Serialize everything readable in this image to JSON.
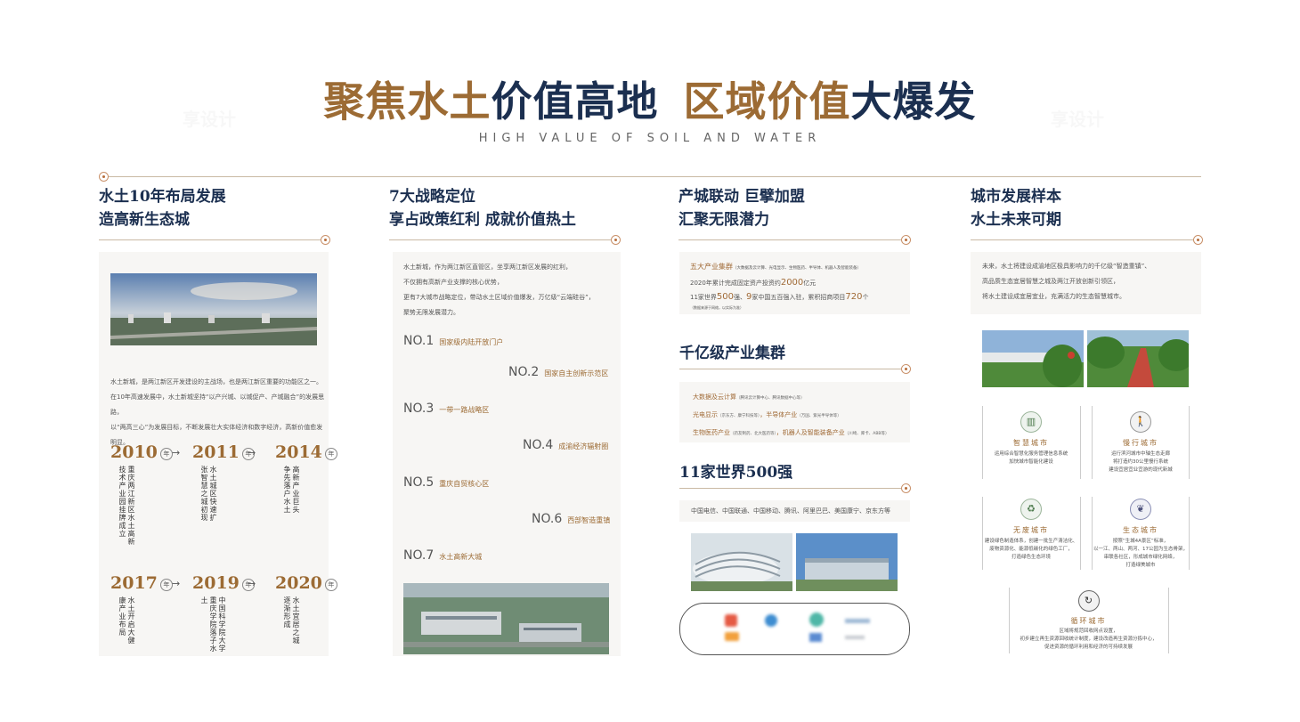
{
  "title": {
    "part1": "聚焦水土",
    "part2": "价值高地",
    "part3": "区域价值",
    "part4": "大爆发"
  },
  "subtitle": "HIGH VALUE OF SOIL AND WATER",
  "col1": {
    "head1": "水土10年布局发展",
    "head2": "造高新生态城",
    "para": [
      "水土新城，是两江新区开发建设的主战场，也是两江新区重要的功能区之一。",
      "在10年高速发展中，水土新城坚持“以产兴城、以城促产、产城融合”的发展思路，",
      "以“两高三心”为发展目标，不断发展壮大实体经济和数字经济，高新价值愈发明显。"
    ],
    "nian": "年",
    "milestones": [
      {
        "year": "2010",
        "text": "重庆两江新区水土高新技术产业园挂牌成立"
      },
      {
        "year": "2011",
        "text": "水土城区快速扩张智慧之城初现"
      },
      {
        "year": "2014",
        "text": "高新产业巨头争先落户水土"
      },
      {
        "year": "2017",
        "text": "水土开启大健康产业布局"
      },
      {
        "year": "2019",
        "text": "中国科学院大学重庆学院落子水土"
      },
      {
        "year": "2020",
        "text": "水土宜居之城逐渐形成"
      }
    ]
  },
  "col2": {
    "head1": "7大战略定位",
    "head2": "享占政策红利 成就价值热土",
    "para": [
      "水土新城，作为两江新区直管区，坐享两江新区发展的红利，",
      "不仅拥有高新产业支撑的核心优势，",
      "更有7大城市战略定位，带动水土区域价值爆发，万亿级“云端硅谷”，",
      "聚势无限发展潜力。"
    ],
    "items": [
      {
        "no": "NO.1",
        "label": "国家级内陆开放门户"
      },
      {
        "no": "NO.2",
        "label": "国家自主创新示范区"
      },
      {
        "no": "NO.3",
        "label": "一带一路战略区"
      },
      {
        "no": "NO.4",
        "label": "成渝经济辐射圈"
      },
      {
        "no": "NO.5",
        "label": "重庆自贸核心区"
      },
      {
        "no": "NO.6",
        "label": "西部智造重镇"
      },
      {
        "no": "NO.7",
        "label": "水土高新大城"
      }
    ]
  },
  "col3": {
    "head1": "产城联动 巨擘加盟",
    "head2": "汇聚无限潜力",
    "box1": {
      "l1a": "五大产业集群",
      "l1b": "（大数据及云计算、光电显示、生物医药、半导体、机器人及智能装备）",
      "l2a": "2020年累计完成固定资产投资约",
      "l2b": "2000",
      "l2c": "亿元",
      "l3a": "11家世界",
      "l3b": "500",
      "l3c": "强、",
      "l3d": "9",
      "l3e": "家中国五百强入驻，累积招商项目",
      "l3f": "720",
      "l3g": "个",
      "l4": "（数据来源于网络，以实际为准）"
    },
    "sec2": "千亿级产业集群",
    "industries": [
      {
        "a": "大数据及云计算",
        "b": "（腾讯云计算中心、腾讯数据中心等）"
      },
      {
        "a": "光电显示",
        "b": "（京东方、康宁科技等）",
        "c": "半导体产业",
        "d": "（万国、紫光半导体等）"
      },
      {
        "a": "生物医药产业",
        "b": "（药友制药、北大医药等）",
        "c": "机器人及智能装备产业",
        "d": "（川崎、库卡、ABB等）"
      }
    ],
    "sec3": "11家世界500强",
    "companies": "中国电信、中国联通、中国移动、腾讯、阿里巴巴、美国康宁、京东方等"
  },
  "col4": {
    "head1": "城市发展样本",
    "head2": "水土未来可期",
    "para": [
      "未来，水土将建设成渝地区极具影响力的千亿级“智造重镇”、",
      "高品质生态宜居智慧之城及两江开放创新引领区，",
      "将水土建设成宜居宜业，充满活力的生态智慧城市。"
    ],
    "cards": [
      {
        "title": "智慧城市",
        "icon": "smart-city-icon",
        "glyph": "▥",
        "desc": [
          "运用综合智慧化服务管理信息系统",
          "加快城市智能化建设"
        ]
      },
      {
        "title": "慢行城市",
        "icon": "walking-icon",
        "glyph": "🚶",
        "desc": [
          "运行滨河城市中轴生态走廊",
          "将打造约30公里慢行系统",
          "建设宜居宜业宜游的现代新城"
        ]
      },
      {
        "title": "无废城市",
        "icon": "leaf-icon",
        "glyph": "♻",
        "desc": [
          "建设绿色制造体系，创建一批生产清洁化、",
          "废物资源化、能源低碳化的绿色工厂，",
          "打造绿色生态环境"
        ]
      },
      {
        "title": "生态城市",
        "icon": "ecology-icon",
        "glyph": "❦",
        "desc": [
          "按照“生城4A景区”标准，",
          "以一江、两山、两河、17公园为生态骨架，",
          "串联各社区，形成城市绿化网络，",
          "打造绿美城市"
        ]
      },
      {
        "title": "循环城市",
        "icon": "recycle-icon",
        "glyph": "↻",
        "desc": [
          "区域将规范回收网点设置，",
          "初步建立再生资源回收统计制度，建设改造再生资源分拣中心，",
          "促进资源的循环利用和经济的可持续发展"
        ]
      }
    ]
  },
  "watermark": "享设计",
  "colors": {
    "gold": "#9c6b34",
    "navy": "#1b2f50",
    "line": "#c9b9a4"
  }
}
